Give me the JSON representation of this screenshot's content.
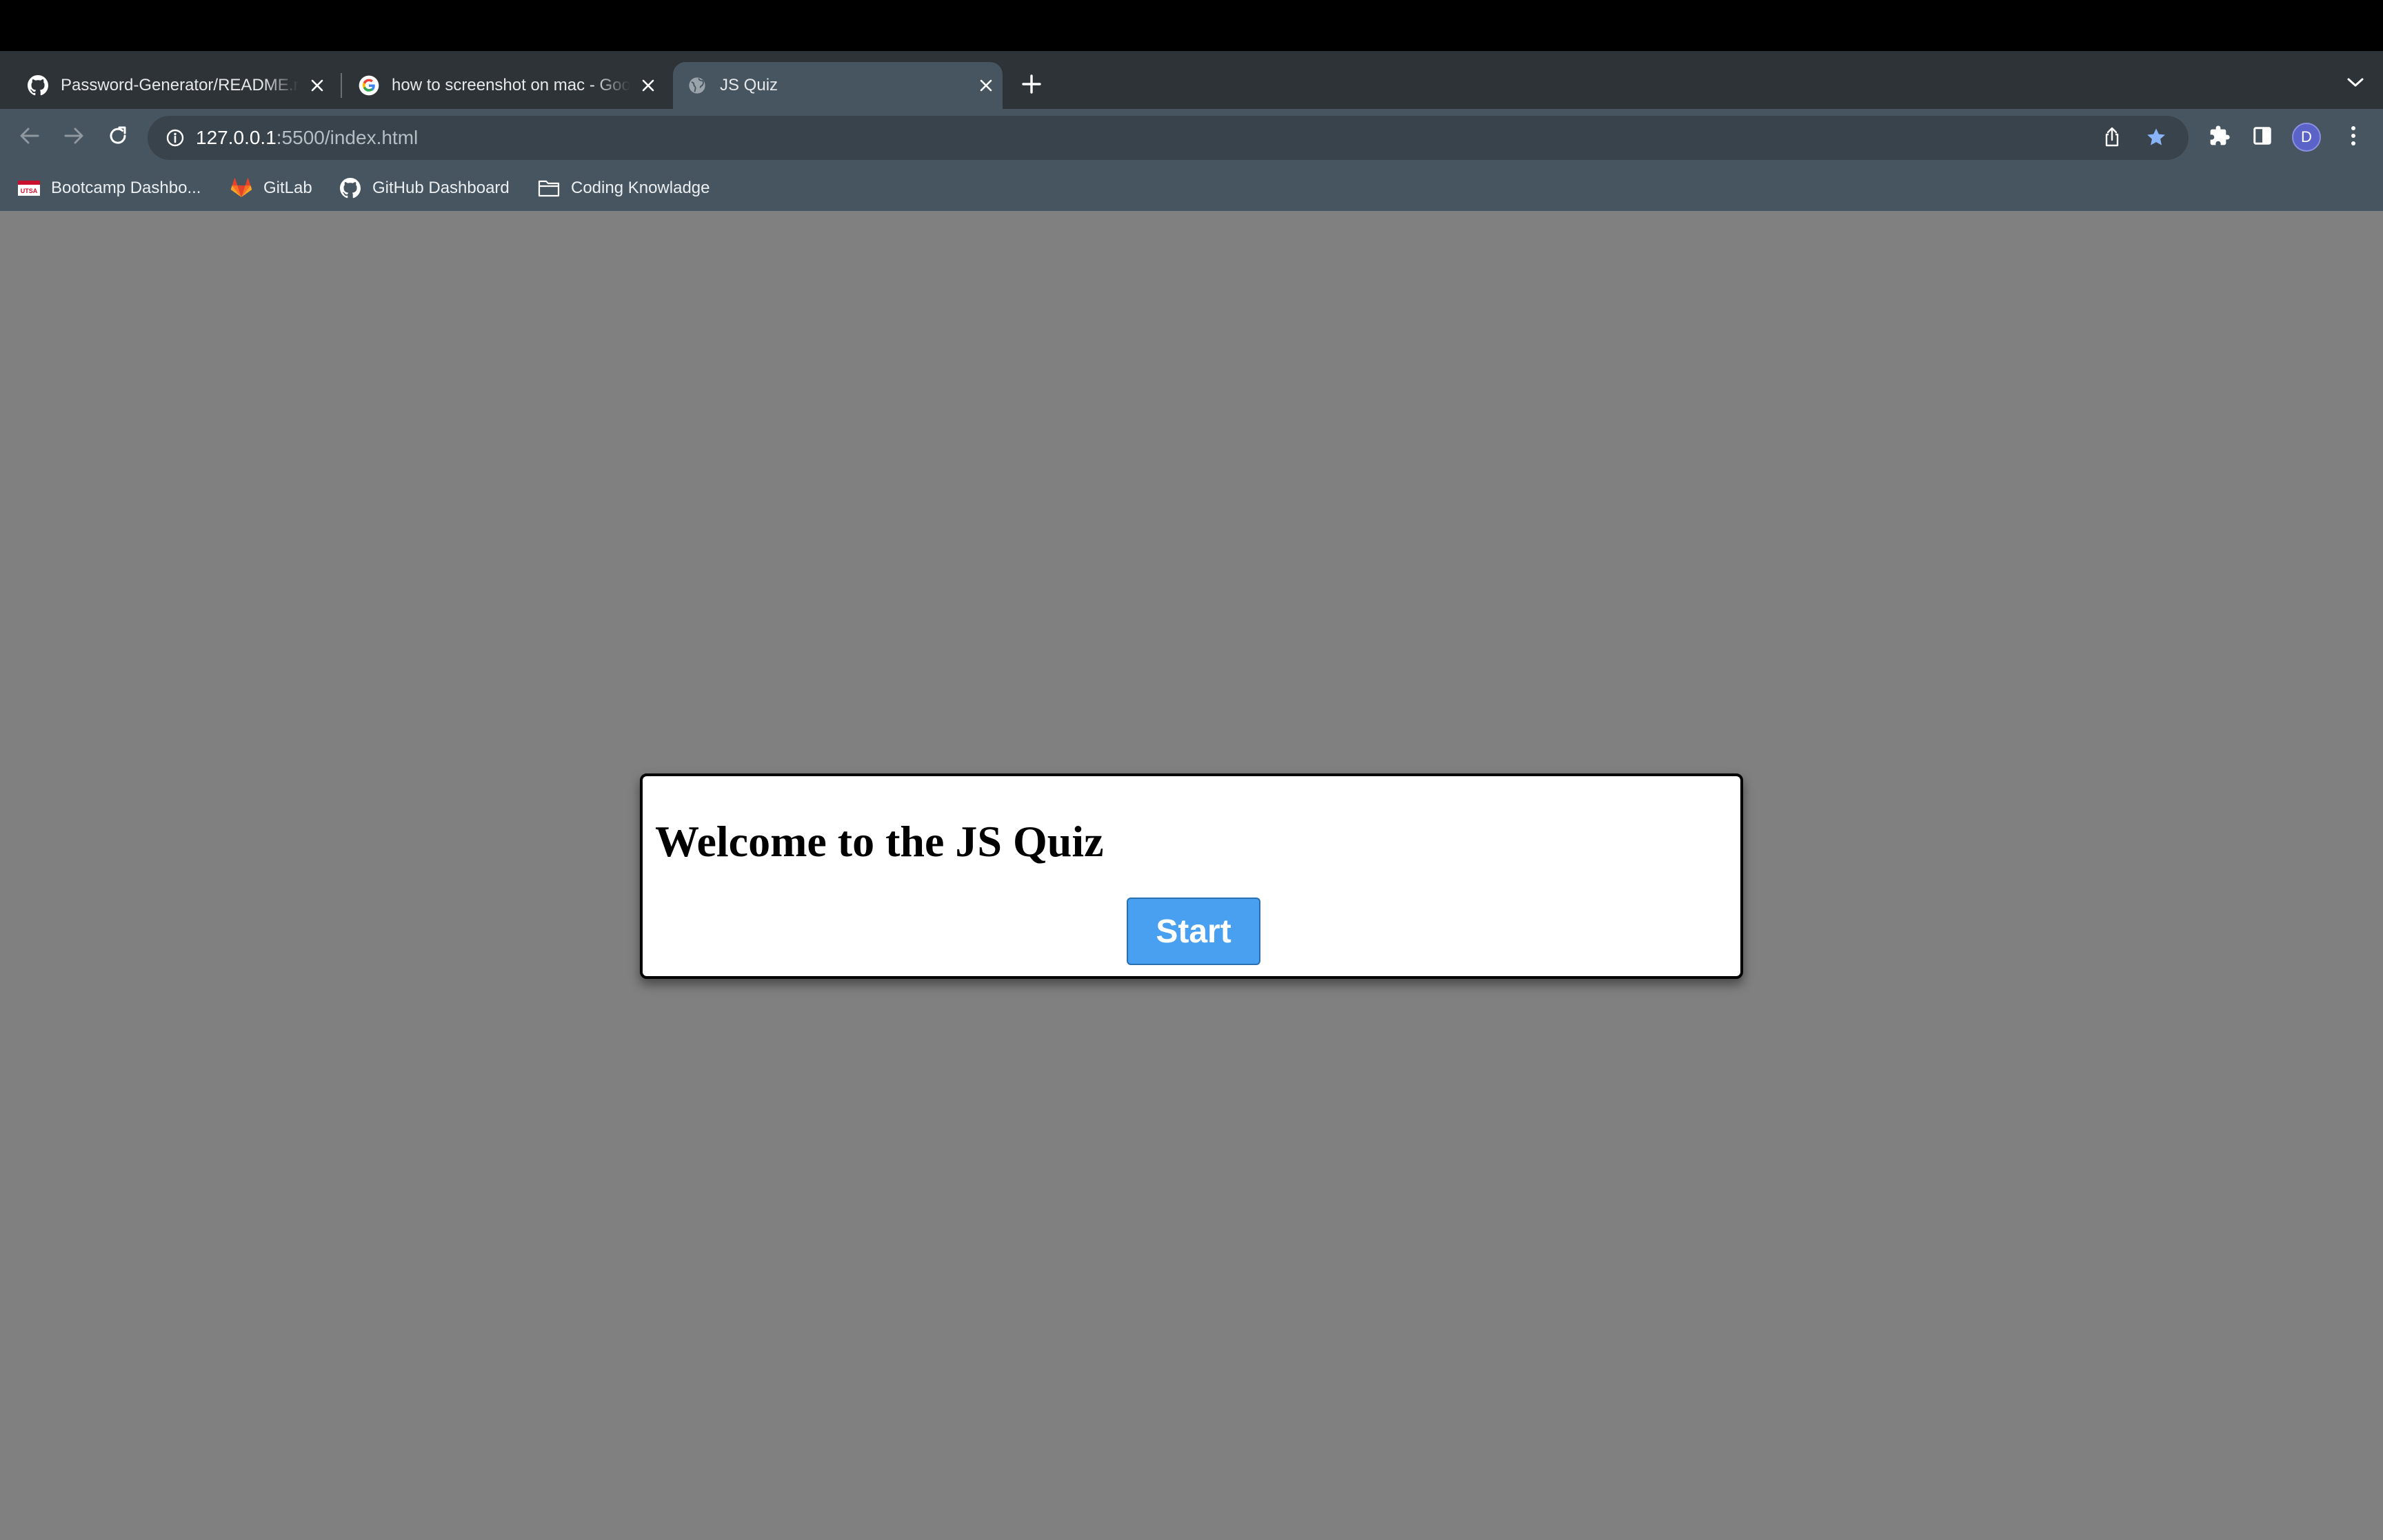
{
  "browser": {
    "tabs": [
      {
        "title": "Password-Generator/README.md",
        "favicon": "github-icon",
        "active": false
      },
      {
        "title": "how to screenshot on mac - Google Search",
        "favicon": "google-icon",
        "active": false
      },
      {
        "title": "JS Quiz",
        "favicon": "globe-icon",
        "active": true
      }
    ],
    "new_tab_label": "+",
    "url": {
      "host": "127.0.0.1",
      "path": ":5500/index.html"
    },
    "profile_initial": "D",
    "bookmarks": [
      {
        "label": "Bootcamp Dashbo...",
        "icon": "bootcamp-icon"
      },
      {
        "label": "GitLab",
        "icon": "gitlab-icon"
      },
      {
        "label": "GitHub Dashboard",
        "icon": "github-icon"
      },
      {
        "label": "Coding Knowladge",
        "icon": "folder-icon"
      }
    ]
  },
  "quiz": {
    "heading": "Welcome to the JS Quiz",
    "start_label": "Start"
  },
  "colors": {
    "page_background": "#808080",
    "button_background": "#49a0f0",
    "tab_active": "#465560",
    "tab_strip": "#2e3338"
  }
}
